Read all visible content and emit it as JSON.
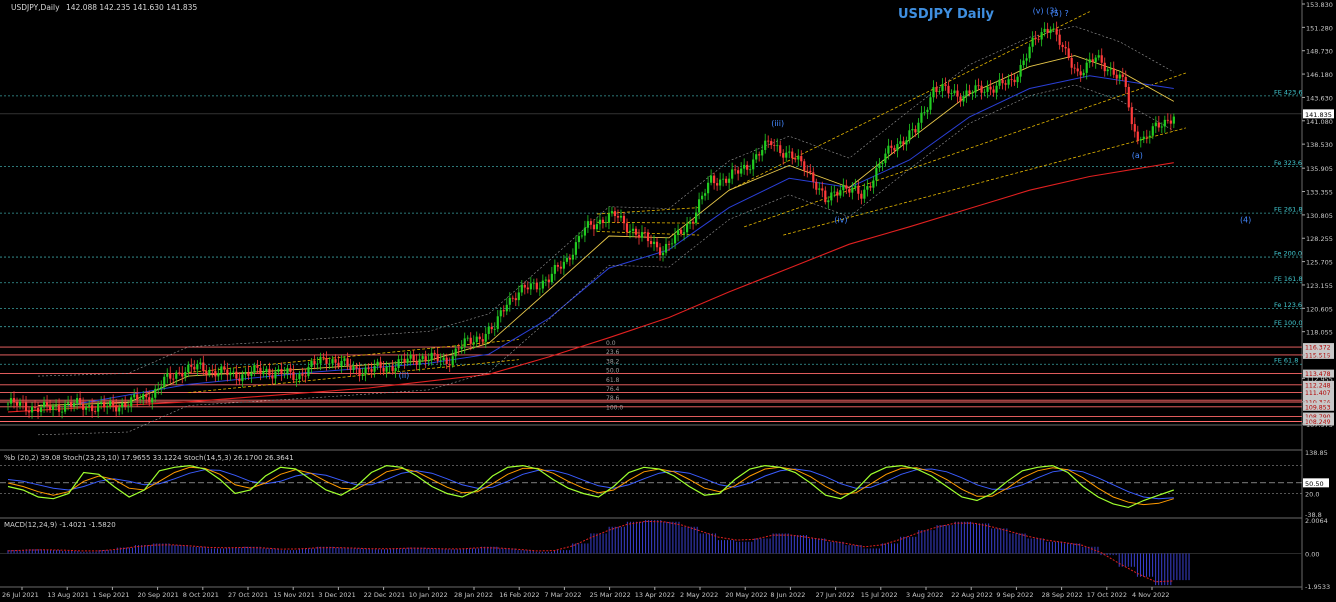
{
  "header": {
    "symbol_info": "USDJPY,Daily",
    "ohlc": "142.088 142.235 141.630 141.835"
  },
  "chart_data": [
    {
      "type": "candlestick",
      "title": "USDJPY Daily",
      "colors": {
        "up": "#22cc22",
        "down": "#ff3b3b",
        "ma_fast": "#e8c84a",
        "ma_mid": "#2a3fd6",
        "ma_slow": "#e02020",
        "channel": "#e6b800",
        "fib_line": "#3aa0a0",
        "fib_label": "#40c8d0",
        "support": "#ff6a6a",
        "wave": "#4488ff"
      },
      "ylim": [
        107.975,
        153.83
      ],
      "y_ticks": [
        "153.830",
        "151.280",
        "148.730",
        "146.180",
        "143.630",
        "141.080",
        "138.530",
        "135.905",
        "133.355",
        "130.805",
        "128.255",
        "125.705",
        "123.155",
        "120.605",
        "118.055",
        "115.505",
        "112.955",
        "110.405",
        "107.975"
      ],
      "current_price": "141.835",
      "x_ticks": [
        "26 Jul 2021",
        "13 Aug 2021",
        "1 Sep 2021",
        "20 Sep 2021",
        "8 Oct 2021",
        "27 Oct 2021",
        "15 Nov 2021",
        "3 Dec 2021",
        "22 Dec 2021",
        "10 Jan 2022",
        "28 Jan 2022",
        "16 Feb 2022",
        "7 Mar 2022",
        "25 Mar 2022",
        "13 Apr 2022",
        "2 May 2022",
        "20 May 2022",
        "8 Jun 2022",
        "27 Jun 2022",
        "15 Jul 2022",
        "3 Aug 2022",
        "22 Aug 2022",
        "9 Sep 2022",
        "28 Sep 2022",
        "17 Oct 2022",
        "4 Nov 2022"
      ],
      "price_path": [
        [
          0,
          110.2
        ],
        [
          12,
          109.6
        ],
        [
          20,
          110.1
        ],
        [
          33,
          109.8
        ],
        [
          40,
          110.3
        ],
        [
          48,
          111.2
        ],
        [
          52,
          112.6
        ],
        [
          58,
          113.9
        ],
        [
          64,
          114.1
        ],
        [
          75,
          113.3
        ],
        [
          86,
          113.8
        ],
        [
          96,
          113.2
        ],
        [
          106,
          115.2
        ],
        [
          114,
          114.1
        ],
        [
          120,
          113.8
        ],
        [
          128,
          114.4
        ],
        [
          138,
          115.3
        ],
        [
          146,
          114.8
        ],
        [
          150,
          116.3
        ],
        [
          162,
          118.4
        ],
        [
          166,
          121.5
        ],
        [
          174,
          123.0
        ],
        [
          180,
          123.8
        ],
        [
          186,
          126.0
        ],
        [
          192,
          129.2
        ],
        [
          198,
          130.4
        ],
        [
          202,
          130.7
        ],
        [
          210,
          128.6
        ],
        [
          218,
          127.0
        ],
        [
          222,
          128.1
        ],
        [
          228,
          130.6
        ],
        [
          234,
          134.6
        ],
        [
          240,
          134.8
        ],
        [
          246,
          136.2
        ],
        [
          254,
          138.8
        ],
        [
          260,
          137.2
        ],
        [
          266,
          136.0
        ],
        [
          272,
          132.1
        ],
        [
          277,
          134.0
        ],
        [
          284,
          132.9
        ],
        [
          294,
          138.2
        ],
        [
          302,
          139.9
        ],
        [
          308,
          144.6
        ],
        [
          318,
          143.9
        ],
        [
          326,
          144.7
        ],
        [
          334,
          145.2
        ],
        [
          340,
          149.0
        ],
        [
          347,
          151.7
        ],
        [
          352,
          148.2
        ],
        [
          356,
          146.4
        ],
        [
          362,
          147.8
        ],
        [
          368,
          146.5
        ],
        [
          372,
          144.8
        ],
        [
          374,
          140.3
        ],
        [
          378,
          139.1
        ],
        [
          382,
          140.2
        ],
        [
          388,
          141.8
        ]
      ],
      "ma_fast": [
        [
          10,
          110.0
        ],
        [
          40,
          110.3
        ],
        [
          60,
          113.2
        ],
        [
          100,
          114.0
        ],
        [
          140,
          114.9
        ],
        [
          160,
          116.8
        ],
        [
          180,
          122.6
        ],
        [
          200,
          128.5
        ],
        [
          220,
          128.3
        ],
        [
          240,
          133.5
        ],
        [
          260,
          136.2
        ],
        [
          280,
          133.8
        ],
        [
          300,
          139.0
        ],
        [
          320,
          144.0
        ],
        [
          340,
          147.0
        ],
        [
          355,
          148.2
        ],
        [
          370,
          146.5
        ],
        [
          388,
          143.2
        ]
      ],
      "ma_mid": [
        [
          20,
          110.0
        ],
        [
          60,
          112.3
        ],
        [
          100,
          113.6
        ],
        [
          140,
          114.6
        ],
        [
          160,
          115.6
        ],
        [
          180,
          119.5
        ],
        [
          200,
          125.0
        ],
        [
          220,
          127.0
        ],
        [
          240,
          131.6
        ],
        [
          260,
          134.8
        ],
        [
          280,
          133.8
        ],
        [
          300,
          136.8
        ],
        [
          320,
          141.5
        ],
        [
          340,
          144.6
        ],
        [
          360,
          146.0
        ],
        [
          388,
          144.6
        ]
      ],
      "ma_slow": [
        [
          0,
          109.3
        ],
        [
          60,
          110.4
        ],
        [
          120,
          111.9
        ],
        [
          160,
          113.4
        ],
        [
          180,
          115.3
        ],
        [
          200,
          117.4
        ],
        [
          220,
          119.6
        ],
        [
          240,
          122.4
        ],
        [
          260,
          125.0
        ],
        [
          280,
          127.6
        ],
        [
          300,
          129.5
        ],
        [
          320,
          131.5
        ],
        [
          340,
          133.5
        ],
        [
          360,
          135.0
        ],
        [
          388,
          136.5
        ]
      ],
      "channel_lines": [
        [
          [
            60,
            113.6
          ],
          [
            170,
            117.2
          ]
        ],
        [
          [
            60,
            111.4
          ],
          [
            170,
            115.0
          ]
        ],
        [
          [
            196,
            130.9
          ],
          [
            230,
            131.6
          ]
        ],
        [
          [
            196,
            129.0
          ],
          [
            230,
            128.6
          ]
        ],
        [
          [
            196,
            130.0
          ],
          [
            230,
            129.9
          ]
        ],
        [
          [
            240,
            133.5
          ],
          [
            360,
            153.0
          ]
        ],
        [
          [
            245,
            129.5
          ],
          [
            392,
            146.3
          ]
        ],
        [
          [
            258,
            128.6
          ],
          [
            392,
            140.3
          ]
        ]
      ],
      "fib_levels": [
        {
          "label": "FE 423.6",
          "price": 143.8
        },
        {
          "label": "Fe 323.6",
          "price": 136.1
        },
        {
          "label": "FE 261.8",
          "price": 131.0
        },
        {
          "label": "Fe 200.0",
          "price": 126.2
        },
        {
          "label": "FE 161.8",
          "price": 123.4
        },
        {
          "label": "Fe 123.6",
          "price": 120.6
        },
        {
          "label": "FE 100.0",
          "price": 118.6
        },
        {
          "label": "FE 61.8",
          "price": 114.5
        }
      ],
      "support_levels": [
        "116.372",
        "115.519",
        "113.478",
        "112.248",
        "111.407",
        "110.572",
        "110.376",
        "109.853",
        "108.790",
        "108.249"
      ],
      "retracement_labels": [
        "0.0",
        "23.6",
        "38.2",
        "50.0",
        "61.8",
        "76.4",
        "78.6",
        "100.0"
      ],
      "wave_labels": [
        {
          "text": "(5) ?",
          "i": 347,
          "price": 152.5
        },
        {
          "text": "(v) (3)",
          "i": 341,
          "price": 152.8
        },
        {
          "text": "(iii)",
          "i": 254,
          "price": 140.5
        },
        {
          "text": "(iv)",
          "i": 275,
          "price": 130.0
        },
        {
          "text": "(a)",
          "i": 374,
          "price": 137.0
        },
        {
          "text": "(4)",
          "i": 410,
          "price": 130.0
        },
        {
          "text": "(ii)",
          "i": 130,
          "price": 113.0
        }
      ]
    },
    {
      "type": "line",
      "title": "%b (20,2) 39.08  Stoch(23,23,10) 17.9655 33.1224  Stoch(14,5,3) 26.1700 26.3641",
      "ylim": [
        -38.8,
        138.85
      ],
      "y_ticks": [
        "138.85",
        "50.50",
        "20.0",
        "-38.8"
      ],
      "colors": {
        "pct_b": "#9fff2e",
        "stoch_slow": "#ff9a00",
        "stoch_signal": "#3a5cff"
      },
      "series": [
        {
          "values": [
            40,
            30,
            10,
            5,
            20,
            80,
            75,
            40,
            10,
            30,
            85,
            95,
            100,
            90,
            60,
            20,
            30,
            70,
            95,
            90,
            60,
            30,
            15,
            40,
            80,
            100,
            95,
            70,
            40,
            20,
            10,
            30,
            70,
            95,
            100,
            90,
            60,
            35,
            20,
            10,
            40,
            80,
            95,
            90,
            70,
            40,
            15,
            20,
            60,
            90,
            100,
            95,
            80,
            50,
            15,
            5,
            30,
            75,
            95,
            100,
            90,
            70,
            40,
            10,
            0,
            20,
            55,
            85,
            95,
            100,
            80,
            40,
            10,
            -10,
            -20,
            0,
            15,
            30
          ]
        },
        {
          "values": [
            50,
            40,
            25,
            15,
            25,
            55,
            70,
            60,
            35,
            30,
            55,
            80,
            95,
            92,
            75,
            45,
            35,
            50,
            75,
            88,
            78,
            55,
            35,
            32,
            55,
            82,
            92,
            82,
            60,
            38,
            22,
            25,
            48,
            75,
            92,
            92,
            78,
            55,
            35,
            22,
            30,
            58,
            82,
            90,
            82,
            60,
            35,
            25,
            42,
            70,
            90,
            95,
            88,
            68,
            40,
            18,
            22,
            48,
            75,
            92,
            94,
            82,
            60,
            32,
            12,
            12,
            35,
            65,
            85,
            94,
            88,
            65,
            35,
            10,
            -5,
            -12,
            -8,
            5
          ]
        },
        {
          "values": [
            60,
            55,
            45,
            35,
            30,
            40,
            55,
            62,
            55,
            45,
            48,
            62,
            78,
            88,
            86,
            72,
            55,
            48,
            55,
            70,
            78,
            72,
            58,
            45,
            45,
            60,
            78,
            85,
            78,
            62,
            45,
            35,
            38,
            55,
            75,
            86,
            86,
            75,
            58,
            42,
            35,
            45,
            62,
            78,
            84,
            78,
            62,
            45,
            38,
            50,
            70,
            85,
            90,
            84,
            68,
            48,
            35,
            38,
            55,
            75,
            88,
            90,
            82,
            65,
            45,
            32,
            32,
            45,
            65,
            82,
            88,
            82,
            65,
            45,
            25,
            10,
            5,
            8
          ]
        }
      ]
    },
    {
      "type": "bar",
      "title": "MACD(12,24,9) -1.4021 -1.5820",
      "ylim": [
        -1.9533,
        2.0064
      ],
      "y_ticks": [
        "2.0064",
        "0.00",
        "-1.9533"
      ],
      "colors": {
        "hist": "#3a3fcf",
        "signal": "#e02020"
      },
      "values": [
        0.2,
        0.25,
        0.2,
        0.15,
        0.1,
        0.2,
        0.35,
        0.5,
        0.6,
        0.5,
        0.4,
        0.3,
        0.35,
        0.4,
        0.3,
        0.2,
        0.3,
        0.4,
        0.35,
        0.3,
        0.25,
        0.3,
        0.35,
        0.3,
        0.25,
        0.3,
        0.4,
        0.3,
        0.2,
        0.1,
        0.2,
        0.6,
        1.2,
        1.6,
        1.9,
        2.0,
        1.9,
        1.6,
        1.2,
        0.8,
        0.7,
        0.9,
        1.2,
        1.1,
        0.9,
        0.7,
        0.5,
        0.3,
        0.6,
        1.0,
        1.4,
        1.7,
        1.9,
        1.8,
        1.5,
        1.2,
        0.9,
        0.7,
        0.6,
        0.4,
        -0.1,
        -0.8,
        -1.4,
        -1.9,
        -1.6
      ],
      "signal": [
        0.15,
        0.2,
        0.22,
        0.2,
        0.15,
        0.15,
        0.25,
        0.4,
        0.5,
        0.52,
        0.45,
        0.36,
        0.34,
        0.36,
        0.33,
        0.26,
        0.27,
        0.34,
        0.35,
        0.32,
        0.28,
        0.28,
        0.32,
        0.31,
        0.27,
        0.28,
        0.35,
        0.32,
        0.25,
        0.15,
        0.17,
        0.45,
        0.95,
        1.4,
        1.75,
        1.92,
        1.9,
        1.7,
        1.35,
        0.98,
        0.8,
        0.85,
        1.1,
        1.1,
        0.95,
        0.78,
        0.6,
        0.4,
        0.52,
        0.85,
        1.25,
        1.58,
        1.82,
        1.82,
        1.6,
        1.32,
        1.02,
        0.8,
        0.65,
        0.48,
        0.05,
        -0.6,
        -1.2,
        -1.7,
        -1.65
      ]
    }
  ]
}
